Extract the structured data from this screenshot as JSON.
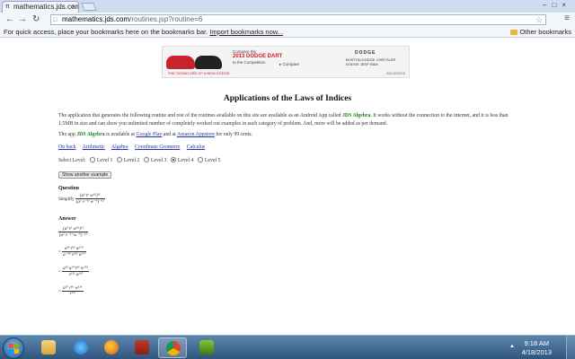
{
  "browser": {
    "tab_title": "mathematics.jds.com",
    "url_host": "mathematics.jds.com",
    "url_path": "/routines.jsp?routine=6",
    "bookmarks_prompt": "For quick access, place your bookmarks here on the bookmarks bar.",
    "import_link": "Import bookmarks now...",
    "other_bookmarks": "Other bookmarks"
  },
  "ad": {
    "line1": "Compare the",
    "line2": "2013 DODGE DART",
    "line3": "to the Competition",
    "compare": "▸ Compare",
    "tagline": "THE SIGNATURE OF A NEW DODGE.",
    "brand": "DODGE",
    "dealer": "BOSTON DODGE CHRYSLER DODGE JEEP RAM",
    "small": "ADCHOICES"
  },
  "page": {
    "title": "Applications of the Laws of Indices",
    "para1_a": "The application that generates the following routine and rest of the routines available on this site are available as an Android App called ",
    "app_name": "JDS Algebra",
    "para1_b": ". It works without the connection to the internet, and it is less than 1.5MB in size and can show you unlimited number of completely worked out examples in each category of problem. And, more will be added as per demand.",
    "para2_a": "The app ",
    "para2_app": "JDS Algebra",
    "para2_b": " is available at ",
    "google_play": "Google Play",
    "para2_c": " and at ",
    "amazon": "Amazon Appstore",
    "para2_d": " for only 99 cents.",
    "nav": [
      "On back",
      "Arithmetic",
      "Algebra",
      "Coordinate Geometry",
      "Calculus"
    ],
    "select_level_label": "Select Level:",
    "levels": [
      "Level 1",
      "Level 2",
      "Level 3",
      "Level 4",
      "Level 5"
    ],
    "selected_level": "Level 4",
    "show_button": "Show another example",
    "question_heading": "Question",
    "simplify_label": "Simplify",
    "answer_heading": "Answer",
    "q_num": "(a³ t⁶ w¹⁶)¹¹",
    "q_den": "(a² v⁻¹¹ w⁻⁵)⁻¹²",
    "a1_num": "(a³ t⁶ w¹⁶)¹¹",
    "a1_den": "(a² v⁻¹¹ w⁻⁵)⁻¹²",
    "a2_num": "a³³ t⁶⁶ w¹⁷⁶",
    "a2_den": "a⁻²⁴ v¹³² w⁶⁰",
    "a3_num": "a³³ a²⁴ t⁶⁶ w¹⁷⁶",
    "a3_den": "v¹³² w⁶⁰",
    "a4_num": "a⁵⁷ t⁶⁶ w¹¹⁶",
    "a4_den": "v¹³²",
    "equals": "="
  },
  "taskbar": {
    "time": "9:18 AM",
    "date": "4/18/2013"
  },
  "colors": {
    "accent_link": "#2233aa",
    "app_green": "#1a7f1a",
    "taskbar": "#3f6790"
  }
}
